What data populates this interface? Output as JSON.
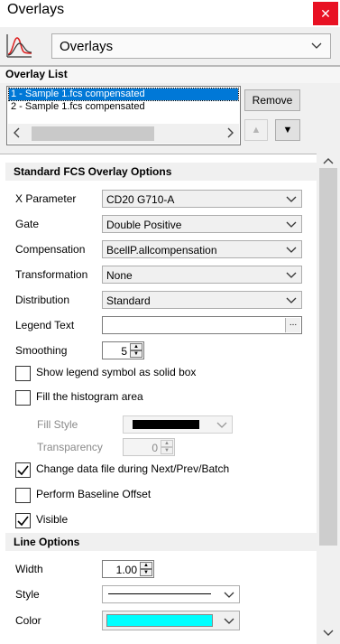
{
  "window": {
    "title": "Overlays",
    "close_icon": "close-icon"
  },
  "header": {
    "view_selector": "Overlays"
  },
  "overlay_list": {
    "section_title": "Overlay List",
    "items": [
      "1 - Sample 1.fcs compensated",
      "2 - Sample 1.fcs compensated"
    ],
    "remove_label": "Remove"
  },
  "standard": {
    "section_title": "Standard FCS Overlay Options",
    "x_parameter": {
      "label": "X Parameter",
      "value": "CD20 G710-A"
    },
    "gate": {
      "label": "Gate",
      "value": "Double Positive"
    },
    "compensation": {
      "label": "Compensation",
      "value": "BcellP.allcompensation"
    },
    "transformation": {
      "label": "Transformation",
      "value": "None"
    },
    "distribution": {
      "label": "Distribution",
      "value": "Standard"
    },
    "legend_text": {
      "label": "Legend Text",
      "value": "",
      "button": "..."
    },
    "smoothing": {
      "label": "Smoothing",
      "value": "5"
    },
    "show_legend_solid": {
      "label": "Show legend symbol as solid box",
      "checked": false
    },
    "fill_histogram": {
      "label": "Fill the histogram area",
      "checked": false
    },
    "fill_style": {
      "label": "Fill Style",
      "color": "#000000"
    },
    "transparency": {
      "label": "Transparency",
      "value": "0"
    },
    "change_data_file": {
      "label": "Change data file during Next/Prev/Batch",
      "checked": true
    },
    "baseline_offset": {
      "label": "Perform Baseline Offset",
      "checked": false
    },
    "visible": {
      "label": "Visible",
      "checked": true
    }
  },
  "line_options": {
    "section_title": "Line Options",
    "width": {
      "label": "Width",
      "value": "1.00"
    },
    "style": {
      "label": "Style"
    },
    "color": {
      "label": "Color",
      "value": "#00ffff"
    }
  }
}
